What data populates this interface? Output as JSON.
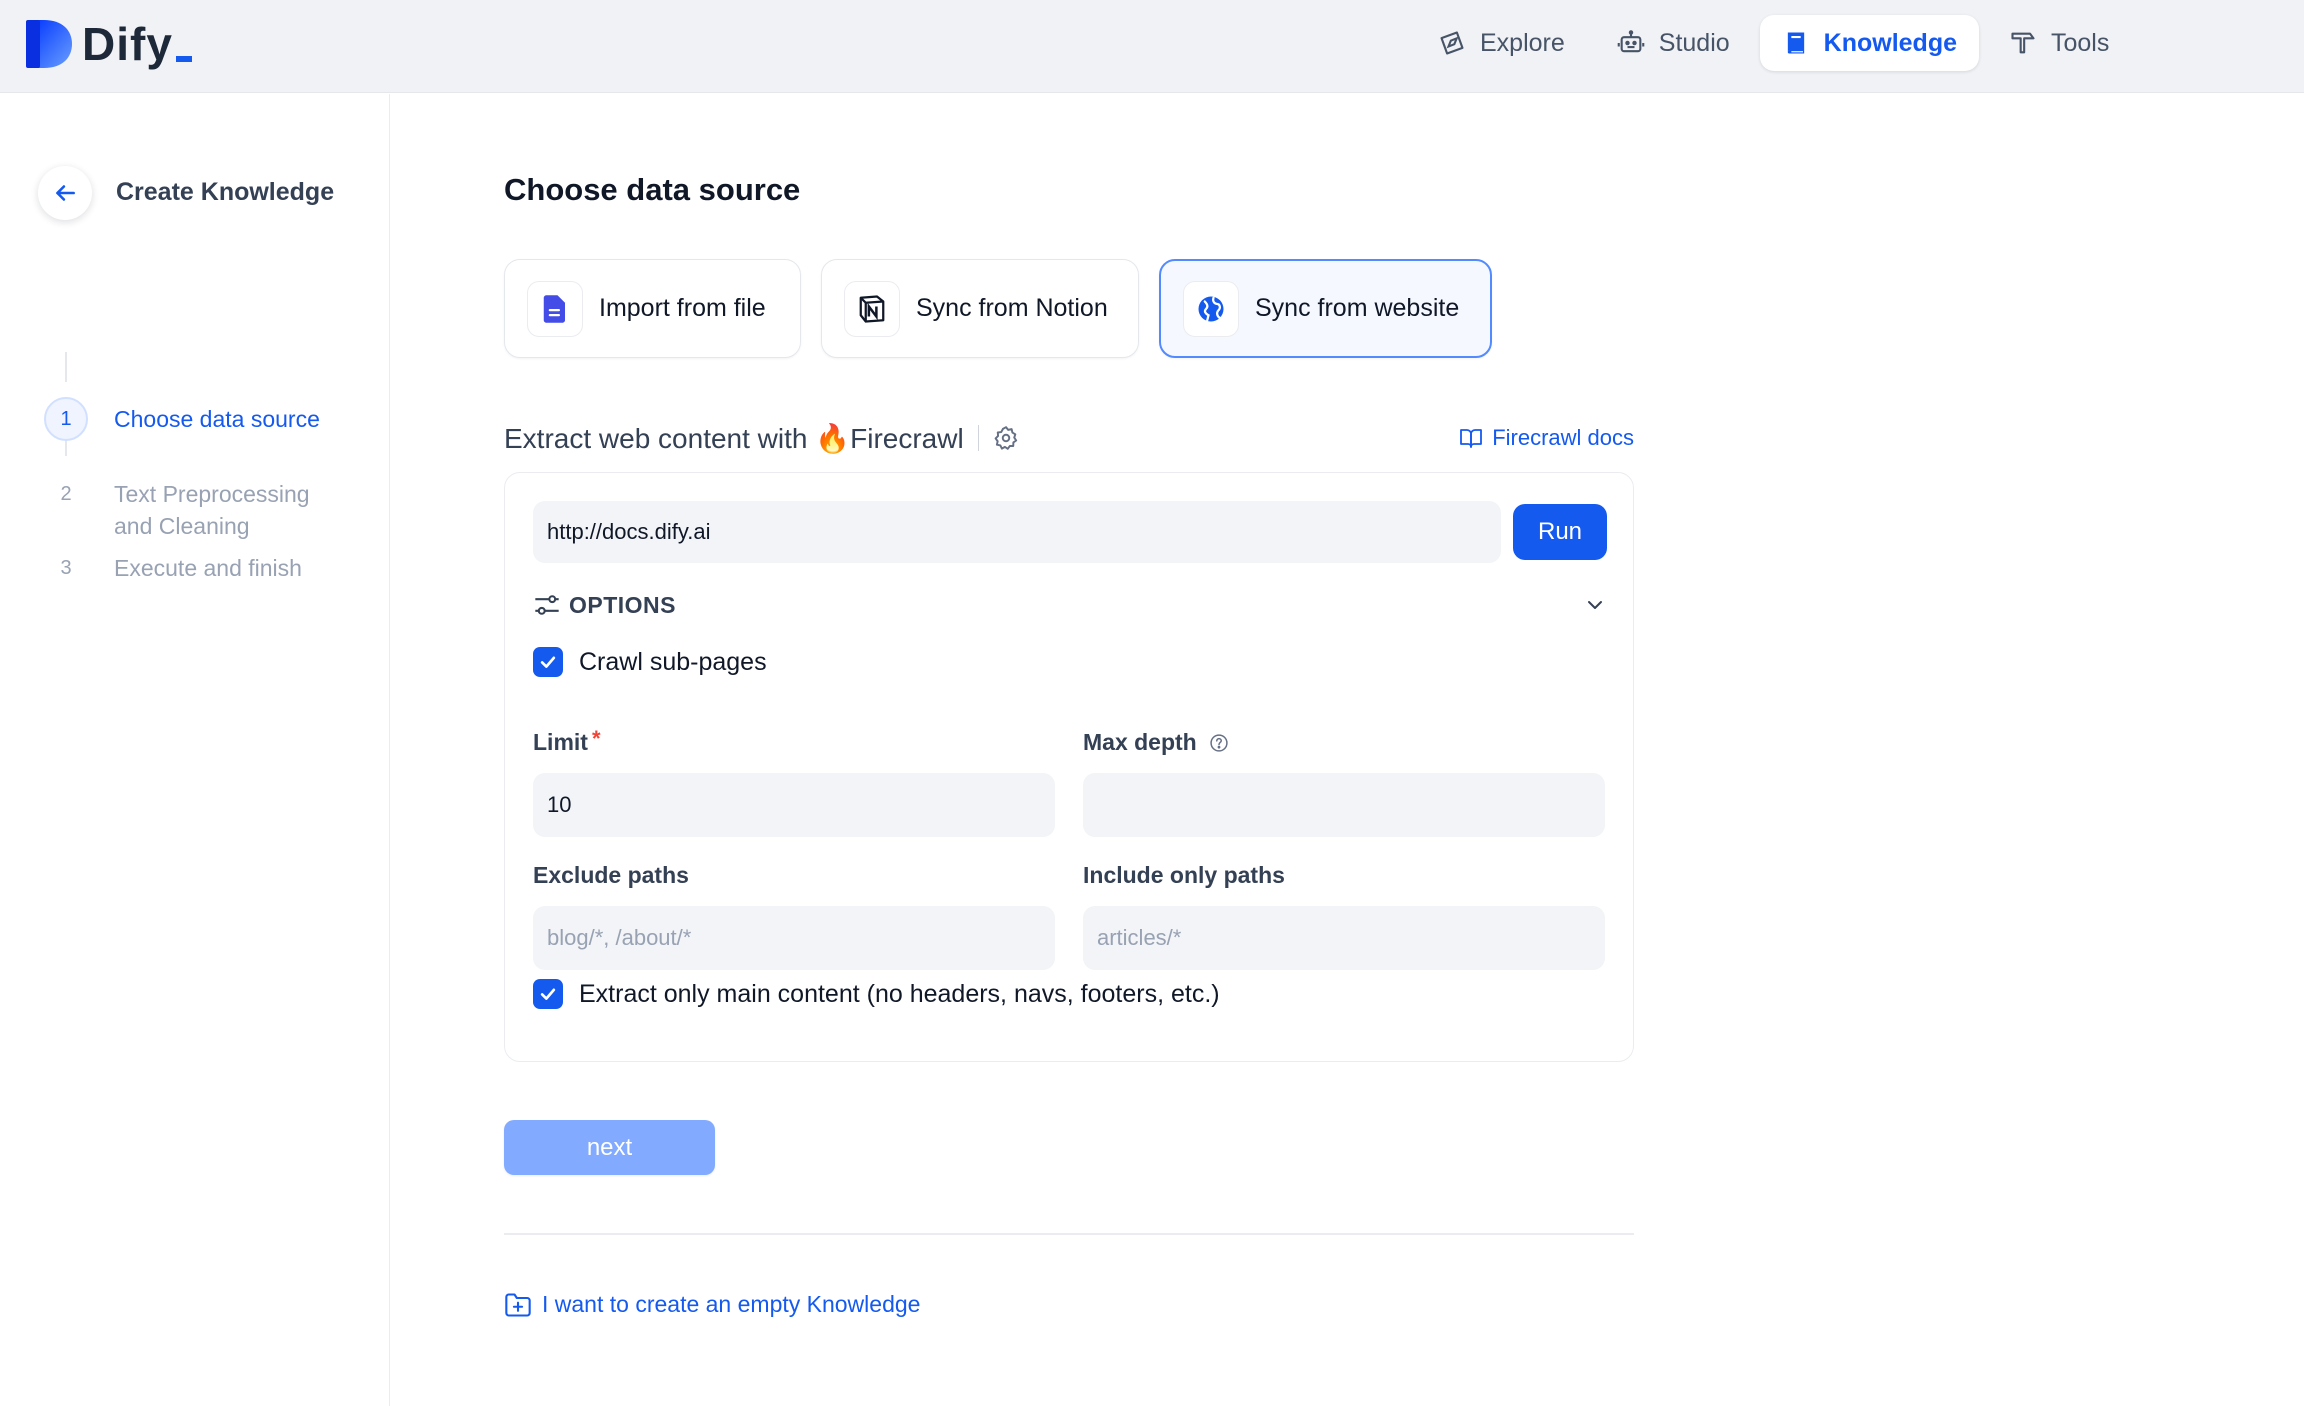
{
  "app": {
    "logo_text": "Dify",
    "brand_color": "#155aef"
  },
  "nav": [
    {
      "label": "Explore",
      "icon": "compass-icon",
      "active": false
    },
    {
      "label": "Studio",
      "icon": "robot-icon",
      "active": false
    },
    {
      "label": "Knowledge",
      "icon": "book-icon",
      "active": true
    },
    {
      "label": "Tools",
      "icon": "hammer-icon",
      "active": false
    }
  ],
  "sidebar": {
    "back_icon": "arrow-left-icon",
    "title": "Create Knowledge",
    "steps": [
      {
        "num": "1",
        "label": "Choose data source",
        "active": true
      },
      {
        "num": "2",
        "label": "Text Preprocessing and Cleaning",
        "active": false
      },
      {
        "num": "3",
        "label": "Execute and finish",
        "active": false
      }
    ]
  },
  "main": {
    "title": "Choose data source",
    "sources": [
      {
        "label": "Import from file",
        "icon": "file-icon",
        "active": false
      },
      {
        "label": "Sync from Notion",
        "icon": "notion-icon",
        "active": false
      },
      {
        "label": "Sync from website",
        "icon": "globe-icon",
        "active": true
      }
    ],
    "extract_title": "Extract web content with 🔥Firecrawl",
    "settings_icon": "gear-icon",
    "docs_link": "Firecrawl docs",
    "url_value": "http://docs.dify.ai",
    "run_label": "Run",
    "options_label": "OPTIONS",
    "crawl_subpages": {
      "label": "Crawl sub-pages",
      "checked": true
    },
    "limit": {
      "label": "Limit",
      "required_mark": "*",
      "value": "10"
    },
    "max_depth": {
      "label": "Max depth",
      "value": ""
    },
    "exclude_paths": {
      "label": "Exclude paths",
      "placeholder": "blog/*, /about/*"
    },
    "include_paths": {
      "label": "Include only paths",
      "placeholder": "articles/*"
    },
    "main_content_only": {
      "label": "Extract only main content (no headers, navs, footers, etc.)",
      "checked": true
    },
    "next_label": "next",
    "empty_link": "I want to create an empty Knowledge"
  }
}
